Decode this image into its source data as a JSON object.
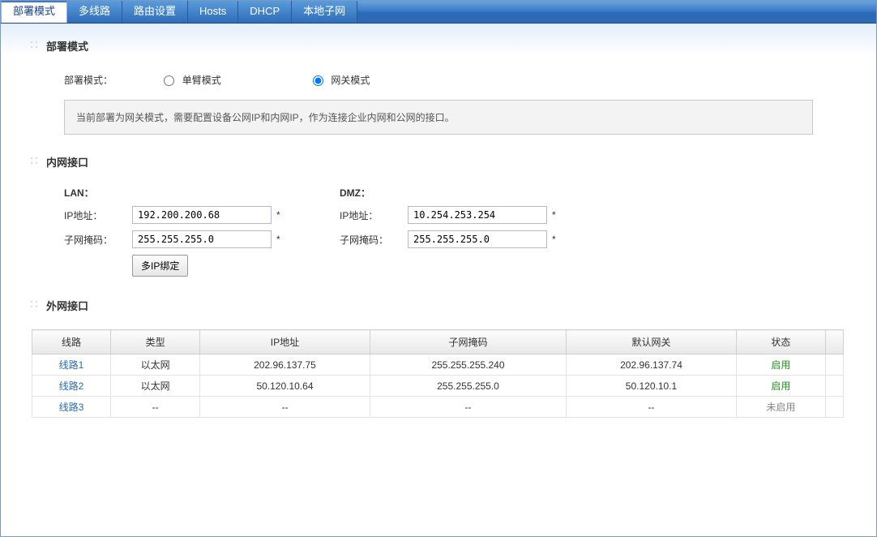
{
  "tabs": {
    "deploy": "部署模式",
    "multiline": "多线路",
    "route": "路由设置",
    "hosts": "Hosts",
    "dhcp": "DHCP",
    "localsubnet": "本地子网"
  },
  "sections": {
    "deploy": "部署模式",
    "lan": "内网接口",
    "wan": "外网接口"
  },
  "mode": {
    "label": "部署模式：",
    "opt_single": "单臂模式",
    "opt_gateway": "网关模式",
    "info": "当前部署为网关模式，需要配置设备公网IP和内网IP，作为连接企业内网和公网的接口。"
  },
  "lan": {
    "hdr": "LAN：",
    "ip_label": "IP地址：",
    "ip_value": "192.200.200.68",
    "mask_label": "子网掩码：",
    "mask_value": "255.255.255.0",
    "multi_ip_btn": "多IP绑定"
  },
  "dmz": {
    "hdr": "DMZ：",
    "ip_label": "IP地址：",
    "ip_value": "10.254.253.254",
    "mask_label": "子网掩码：",
    "mask_value": "255.255.255.0"
  },
  "wan": {
    "headers": {
      "line": "线路",
      "type": "类型",
      "ip": "IP地址",
      "mask": "子网掩码",
      "gw": "默认网关",
      "status": "状态"
    },
    "rows": [
      {
        "line": "线路1",
        "type": "以太网",
        "ip": "202.96.137.75",
        "mask": "255.255.255.240",
        "gw": "202.96.137.74",
        "status": "启用",
        "on": true
      },
      {
        "line": "线路2",
        "type": "以太网",
        "ip": "50.120.10.64",
        "mask": "255.255.255.0",
        "gw": "50.120.10.1",
        "status": "启用",
        "on": true
      },
      {
        "line": "线路3",
        "type": "--",
        "ip": "--",
        "mask": "--",
        "gw": "--",
        "status": "未启用",
        "on": false
      }
    ]
  },
  "req_mark": "*"
}
